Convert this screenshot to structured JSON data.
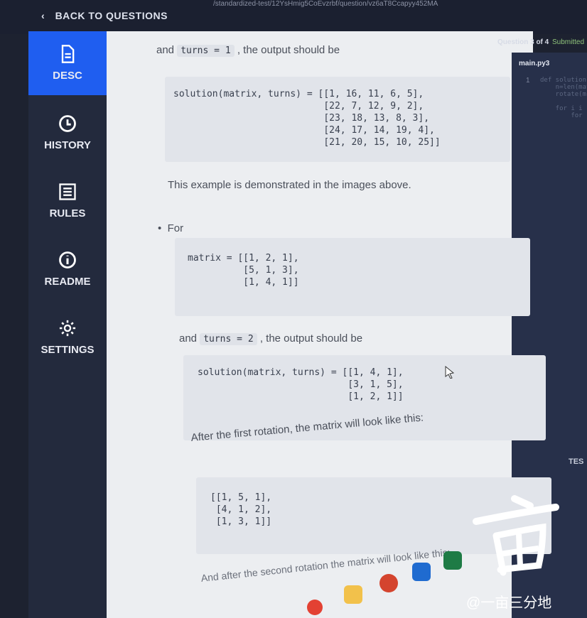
{
  "browser": {
    "url": "/standardized-test/12YsHmig5CoEvzrbf/question/vz6aT8Ccapyy452MA"
  },
  "header": {
    "back_label": "BACK TO QUESTIONS",
    "question_counter": "Question 3 of 4",
    "question_status": "Submitted"
  },
  "sidebar": {
    "items": [
      {
        "label": "DESC",
        "icon": "file-icon"
      },
      {
        "label": "HISTORY",
        "icon": "clock-icon"
      },
      {
        "label": "RULES",
        "icon": "list-icon"
      },
      {
        "label": "README",
        "icon": "info-icon"
      },
      {
        "label": "SETTINGS",
        "icon": "gear-icon"
      }
    ]
  },
  "editor": {
    "tab": "main.py3",
    "line_number": "1",
    "code_fragment": "def solution(\n    n=len(mat\n    rotate(m\n\n    for i i\n        for"
  },
  "description": {
    "line1_prefix": "and",
    "line1_code": "turns = 1",
    "line1_suffix": ", the output should be",
    "example1_code": "solution(matrix, turns) = [[1, 16, 11, 6, 5],\n                           [22, 7, 12, 9, 2],\n                           [23, 18, 13, 8, 3],\n                           [24, 17, 14, 19, 4],\n                           [21, 20, 15, 10, 25]]",
    "demo_text": "This example is demonstrated in the images above.",
    "bullet_text": "For",
    "matrix_code": "matrix = [[1, 2, 1],\n          [5, 1, 3],\n          [1, 4, 1]]",
    "and_text": "and",
    "turns2_code": "turns = 2",
    "output_text": ", the output should be",
    "example2_code": "solution(matrix, turns) = [[1, 4, 1],\n                           [3, 1, 5],\n                           [1, 2, 1]]",
    "first_rotation_text": "After the first rotation, the matrix will look like this:",
    "first_rotation_code": "[[1, 5, 1],\n [4, 1, 2],\n [1, 3, 1]]",
    "second_rotation_text": "And after the second rotation the matrix will look like this:"
  },
  "editor_side": {
    "tests_label": "TES"
  },
  "watermark": {
    "text": "@一亩三分地"
  }
}
